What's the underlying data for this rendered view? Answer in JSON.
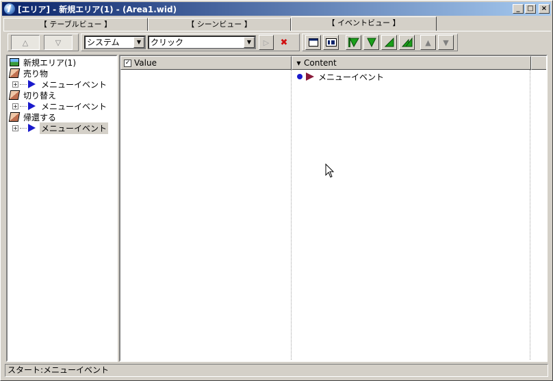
{
  "window": {
    "title": "[エリア] - 新規エリア(1) - (Area1.wid)",
    "caption_buttons": {
      "minimize": "_",
      "maximize": "□",
      "close": "×"
    }
  },
  "tabs": [
    {
      "label": "【 テーブルビュー 】"
    },
    {
      "label": "【 シーンビュー 】"
    },
    {
      "label": "【 イベントビュー 】"
    }
  ],
  "toolbar": {
    "up_glyph": "△",
    "down_glyph": "▽",
    "category_select": "システム",
    "trigger_select": "クリック",
    "play_glyph": "▷",
    "stop_glyph": "✖",
    "move_up_glyph": "▲",
    "move_down_glyph": "▼",
    "dropdown_glyph": "▼"
  },
  "tree": {
    "root": "新規エリア(1)",
    "groups": [
      {
        "label": "売り物",
        "child": "メニューイベント"
      },
      {
        "label": "切り替え",
        "child": "メニューイベント"
      },
      {
        "label": "帰還する",
        "child": "メニューイベント"
      }
    ],
    "expander": "+"
  },
  "grid": {
    "columns": [
      {
        "label": "Value",
        "check": "✓"
      },
      {
        "label": "Content",
        "dropdown": "▼"
      }
    ],
    "rows": [
      {
        "content": "メニューイベント"
      }
    ]
  },
  "status": {
    "text": "スタート:メニューイベント"
  },
  "colors": {
    "title_gradient_start": "#0a246a",
    "title_gradient_end": "#a6caf0",
    "tree_event_icon": "#1a1acc",
    "content_event_icon": "#8a1a3a",
    "content_dot": "#1a1acc"
  }
}
